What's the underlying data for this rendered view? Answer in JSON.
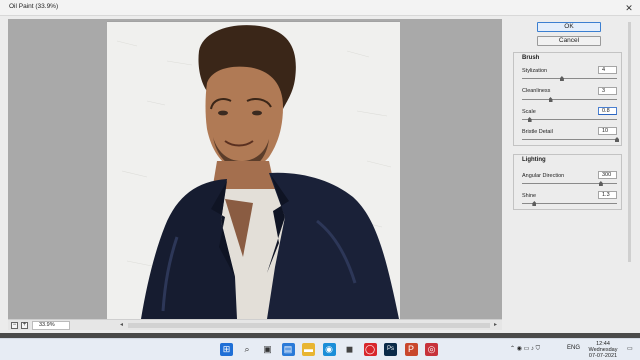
{
  "window": {
    "title": "Oil Paint (33.9%)",
    "close_glyph": "✕"
  },
  "buttons": {
    "ok": "OK",
    "cancel": "Cancel"
  },
  "brush": {
    "title": "Brush",
    "params": [
      {
        "label": "Stylization",
        "value": "4",
        "level": 0.42
      },
      {
        "label": "Cleanliness",
        "value": "3",
        "level": 0.3
      },
      {
        "label": "Scale",
        "value": "0.8",
        "level": 0.08
      },
      {
        "label": "Bristle Detail",
        "value": "10",
        "level": 1.0
      }
    ]
  },
  "lighting": {
    "title": "Lighting",
    "params": [
      {
        "label": "Angular Direction",
        "value": "300",
        "level": 0.83
      },
      {
        "label": "Shine",
        "value": "1.3",
        "level": 0.13
      }
    ]
  },
  "status": {
    "zoom_out": "−",
    "zoom_in": "+",
    "zoom_level": "33.9%"
  },
  "taskbar": {
    "apps": [
      {
        "name": "windows-start-icon",
        "glyph": "⊞",
        "color": "#1f6fd6"
      },
      {
        "name": "search-icon",
        "glyph": "⌕",
        "color": "#333333"
      },
      {
        "name": "task-view-icon",
        "glyph": "▣",
        "color": "#333333"
      },
      {
        "name": "widgets-icon",
        "glyph": "▤",
        "color": "#2a7ad8"
      },
      {
        "name": "file-explorer-icon",
        "glyph": "▬",
        "color": "#e8b532"
      },
      {
        "name": "edge-icon",
        "glyph": "◉",
        "color": "#1a8ed8"
      },
      {
        "name": "store-icon",
        "glyph": "◼",
        "color": "#444444"
      },
      {
        "name": "opera-icon",
        "glyph": "◯",
        "color": "#d8262b"
      },
      {
        "name": "photoshop-icon",
        "glyph": "Ps",
        "color": "#0b2a48"
      },
      {
        "name": "powerpoint-icon",
        "glyph": "P",
        "color": "#c9472c"
      },
      {
        "name": "record-icon",
        "glyph": "◎",
        "color": "#c7323a"
      }
    ],
    "language": "ENG",
    "time": "12:44",
    "day": "Wednesday",
    "date": "07-07-2021"
  },
  "colors": {
    "accent": "#3c7fd0"
  }
}
